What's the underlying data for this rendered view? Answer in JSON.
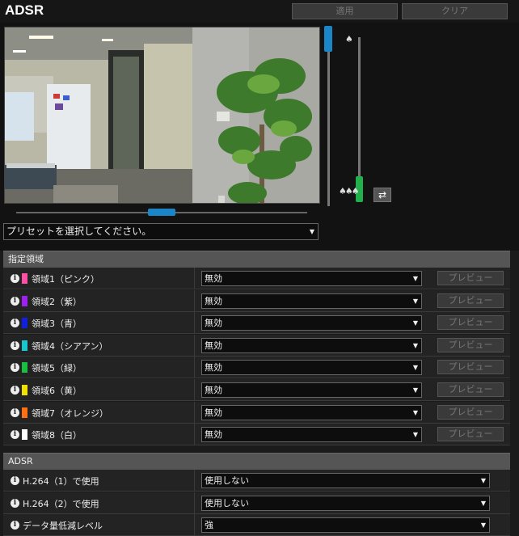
{
  "header": {
    "title": "ADSR",
    "apply_label": "適用",
    "clear_label": "クリア"
  },
  "camera": {
    "preset_placeholder": "プリセットを選択してください。"
  },
  "regions_section": {
    "title": "指定領域",
    "rows": [
      {
        "label": "領域1（ピンク）",
        "color": "#ff4fa6",
        "value": "無効",
        "preview": "プレビュー"
      },
      {
        "label": "領域2（紫）",
        "color": "#a020f0",
        "value": "無効",
        "preview": "プレビュー"
      },
      {
        "label": "領域3（青）",
        "color": "#1020e0",
        "value": "無効",
        "preview": "プレビュー"
      },
      {
        "label": "領域4（シアアン）",
        "color": "#18c8d0",
        "value": "無効",
        "preview": "プレビュー"
      },
      {
        "label": "領域5（緑）",
        "color": "#18c040",
        "value": "無効",
        "preview": "プレビュー"
      },
      {
        "label": "領域6（黄）",
        "color": "#f0e000",
        "value": "無効",
        "preview": "プレビュー"
      },
      {
        "label": "領域7（オレンジ）",
        "color": "#ff7010",
        "value": "無効",
        "preview": "プレビュー"
      },
      {
        "label": "領域8（白）",
        "color": "#ffffff",
        "value": "無効",
        "preview": "プレビュー"
      }
    ]
  },
  "adsr_section": {
    "title": "ADSR",
    "rows": [
      {
        "label": "H.264（1）で使用",
        "value": "使用しない"
      },
      {
        "label": "H.264（2）で使用",
        "value": "使用しない"
      },
      {
        "label": "データ量低減レベル",
        "value": "強"
      }
    ]
  }
}
